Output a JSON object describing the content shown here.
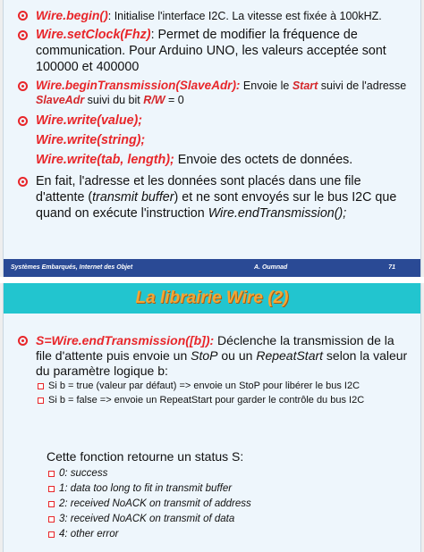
{
  "slide1": {
    "bullets": [
      {
        "code": "Wire.begin()",
        "text": ": Initialise l'interface I2C. La vitesse est fixée à 100kHZ."
      },
      {
        "code": "Wire.setClock(Fhz)",
        "text": ": Permet de modifier la fréquence de communication. Pour Arduino UNO, les valeurs acceptée sont 100000 et 400000"
      },
      {
        "code": "Wire.beginTransmission(SlaveAdr):",
        "t1": " Envoie le ",
        "k1": "Start",
        "t2": " suivi de l'adresse ",
        "k2": "SlaveAdr",
        "t3": " suivi du bit ",
        "k3": "R/W",
        "t4": " = 0"
      },
      {
        "code1": "Wire.write(value);",
        "code2": "Wire.write(string);",
        "code3": "Wire.write(tab, length);",
        "text": " Envoie des octets de données."
      },
      {
        "t1": "En fait, l'adresse et les données sont placés dans une file d'attente (",
        "k1": "transmit buffer",
        "t2": ") et ne sont envoyés sur le bus I2C que quand on exécute l'instruction ",
        "k2": "Wire.endTransmission();"
      }
    ],
    "footer": {
      "left": "Systèmes Embarqués, Internet des Objet",
      "center": "A. Oumnad",
      "page": "71"
    }
  },
  "slide2": {
    "title": "La librairie Wire (2)",
    "bullet": {
      "code": "S=Wire.endTransmission([b]):",
      "t1": " Déclenche la transmission de la file d'attente puis envoie un ",
      "k1": "StoP",
      "t2": " ou un ",
      "k2": "RepeatStart",
      "t3": " selon la valeur du paramètre logique b:"
    },
    "sub": [
      "Si b = true (valeur par défaut) => envoie un StoP pour libérer le bus I2C",
      "Si b = false => envoie un RepeatStart pour garder le contrôle du bus I2C"
    ],
    "status_intro": "Cette fonction retourne un status S:",
    "codes": [
      "0:  success",
      "1:  data too long to fit in transmit buffer",
      "2:  received NoACK on transmit of address",
      "3:  received NoACK on transmit of data",
      "4:  other error"
    ]
  },
  "colors": {
    "title_bar": "#22c5cf",
    "title_text": "#f4a534",
    "footer": "#2a4a95",
    "accent": "#e8262a",
    "slide_bg": "#eef6fc"
  }
}
